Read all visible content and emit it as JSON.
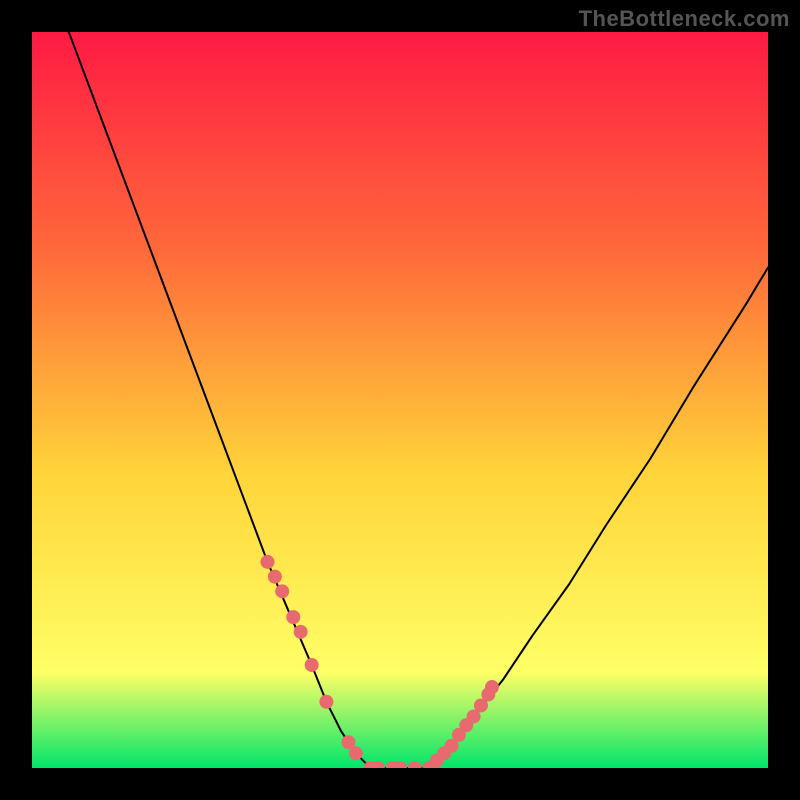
{
  "brand": "TheBottleneck.com",
  "chart_data": {
    "type": "line",
    "title": "",
    "xlabel": "",
    "ylabel": "",
    "xlim": [
      0,
      100
    ],
    "ylim": [
      0,
      100
    ],
    "grid": false,
    "legend": false,
    "background_gradient": [
      "#ff1a44",
      "#ff6a3a",
      "#ffd43a",
      "#ffff66",
      "#00e56a"
    ],
    "series": [
      {
        "name": "left-curve",
        "x": [
          5,
          8,
          11,
          14,
          17,
          20,
          23,
          26,
          29,
          32,
          35,
          38,
          40,
          42,
          44,
          46
        ],
        "y": [
          100,
          92,
          84,
          76,
          68,
          60,
          52,
          44,
          36,
          28,
          21,
          14,
          9,
          5,
          2,
          0
        ]
      },
      {
        "name": "floor",
        "x": [
          46,
          54
        ],
        "y": [
          0,
          0
        ]
      },
      {
        "name": "right-curve",
        "x": [
          54,
          57,
          60,
          64,
          68,
          73,
          78,
          84,
          90,
          97,
          100
        ],
        "y": [
          0,
          3,
          7,
          12,
          18,
          25,
          33,
          42,
          52,
          63,
          68
        ]
      }
    ],
    "scatter": [
      {
        "name": "left-points",
        "x": [
          32,
          33,
          34,
          35.5,
          36.5,
          38,
          40,
          43,
          44,
          46,
          47,
          49,
          50,
          52,
          54
        ],
        "y": [
          28,
          26,
          24,
          20.5,
          18.5,
          14,
          9,
          3.5,
          2,
          0,
          0,
          0,
          0,
          0,
          0
        ]
      },
      {
        "name": "right-points",
        "x": [
          55,
          56,
          57,
          58,
          59,
          60,
          61,
          62,
          62.5
        ],
        "y": [
          1,
          2,
          3,
          4.5,
          5.8,
          7,
          8.5,
          10,
          11
        ]
      }
    ],
    "style": {
      "curve_stroke": "#000000",
      "curve_width": 2,
      "point_fill": "#e86a6f",
      "point_radius": 7
    }
  }
}
